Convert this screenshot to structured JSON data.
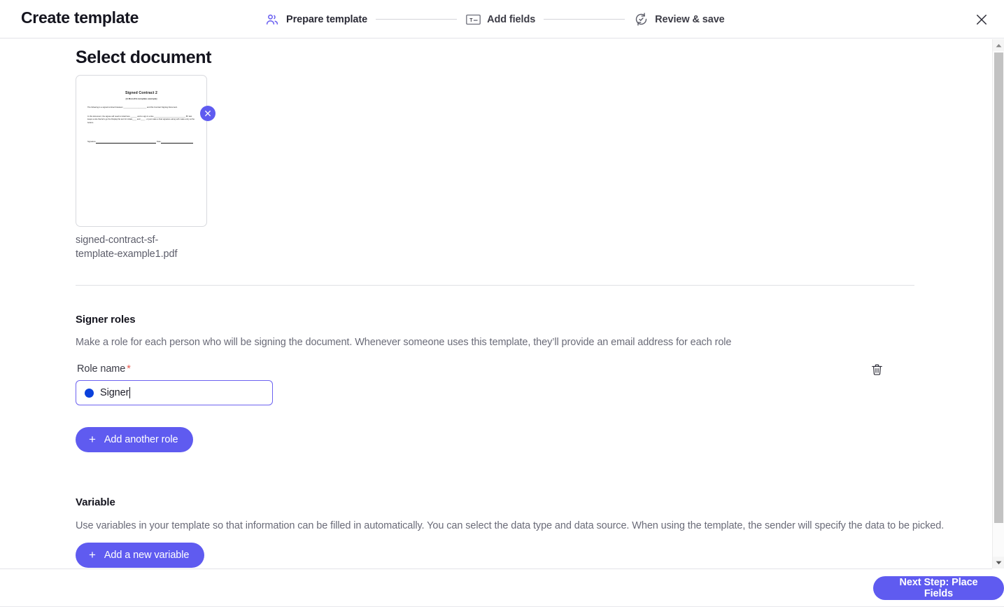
{
  "header": {
    "title": "Create template",
    "steps": [
      {
        "label": "Prepare template",
        "icon": "users-icon",
        "active": true
      },
      {
        "label": "Add fields",
        "icon": "text-field-icon",
        "active": false
      },
      {
        "label": "Review & save",
        "icon": "review-sync-check-icon",
        "active": false
      }
    ],
    "close_icon": "close-icon"
  },
  "main": {
    "select_document": {
      "heading": "Select document",
      "document": {
        "file_name": "signed-contract-sf-template-example1.pdf",
        "remove_icon": "close-circle-icon",
        "preview": {
          "title": "Signed Contract 2",
          "subtitle": "[A MonoFlo template example]",
          "paragraph1": "The following is a signed contract between ______________________ and this Contract Signing Document.",
          "paragraph2": "In this document, the signee will need to initial here ______ and to sign in a line ______________________________ BY last keeps a site that let's go the Display file text for initials____ and ____ , or just make a final signature along with make entry at the bottom.",
          "signature_label": "Signature:",
          "date_label": "Date:"
        }
      }
    },
    "signer_roles": {
      "title": "Signer roles",
      "description": "Make a role for each person who will be signing the document. Whenever someone uses this template, they’ll provide an email address for each role",
      "field_label": "Role name",
      "required_marker": "*",
      "role_value": "Signer",
      "role_color": "#0b41dc",
      "delete_icon": "trash-icon",
      "add_button": "Add another role"
    },
    "variable": {
      "title": "Variable",
      "description": "Use variables in your template so that information can be filled in automatically. You can select the data type and data source. When using the template, the sender will specify the data to be picked.",
      "add_button": "Add a new variable"
    }
  },
  "footer": {
    "next_button": "Next Step: Place Fields"
  },
  "theme": {
    "accent": "#5f5bf0",
    "text_primary": "#14141e",
    "text_secondary": "#6a6b78",
    "border": "#e3e4e8",
    "required_red": "#e7584f"
  }
}
